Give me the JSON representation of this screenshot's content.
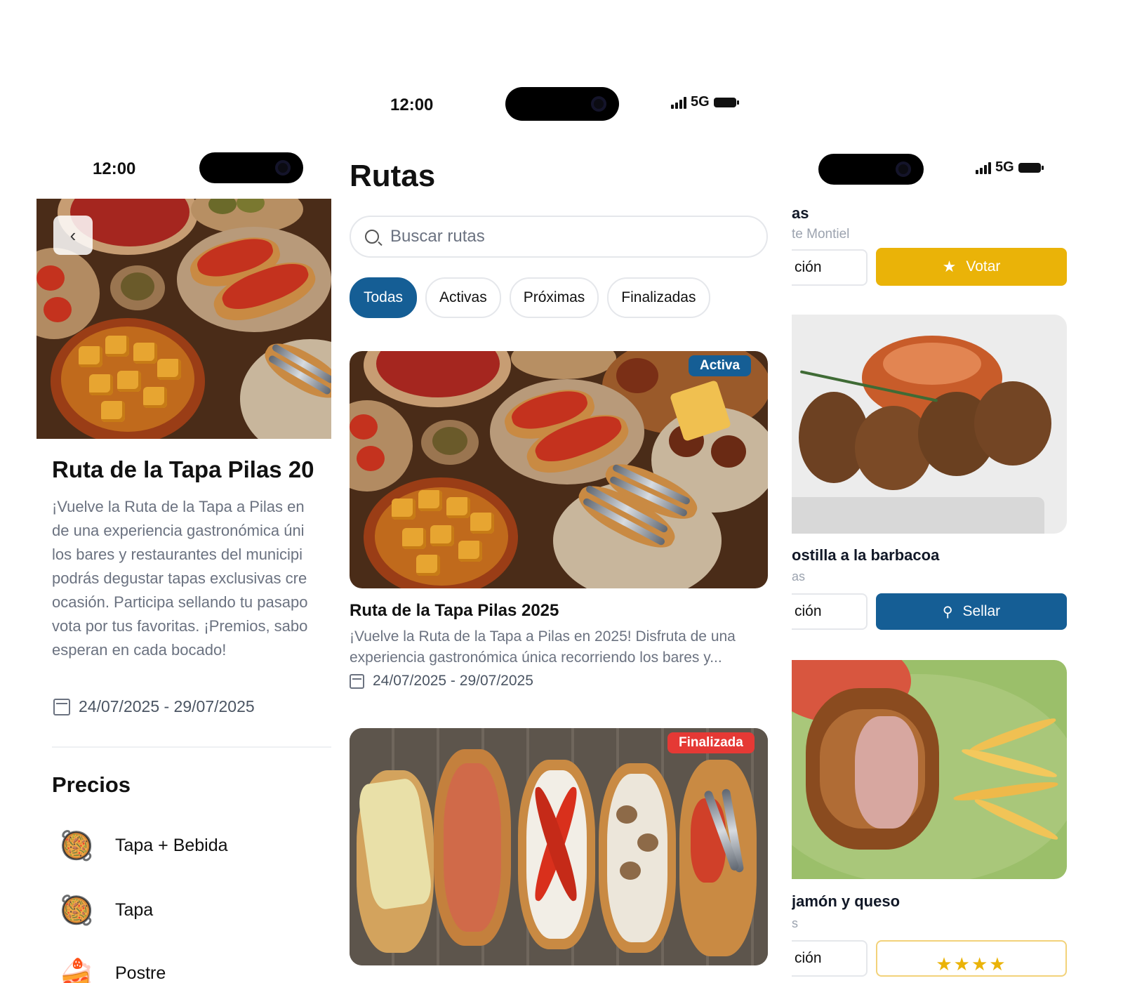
{
  "left_screen": {
    "status_time": "12:00",
    "back_label": "‹",
    "title": "Ruta de la Tapa Pilas 20",
    "description_lines": [
      "¡Vuelve la Ruta de la Tapa a Pilas en",
      "de una experiencia gastronómica úni",
      "los bares y restaurantes del municipi",
      "podrás degustar tapas exclusivas cre",
      "ocasión. Participa sellando tu pasapo",
      "vota por tus favoritas. ¡Premios, sabo",
      "esperan en cada bocado!"
    ],
    "dates": "24/07/2025 - 29/07/2025",
    "prices_title": "Precios",
    "prices": [
      {
        "emoji": "🥘",
        "label": "Tapa + Bebida"
      },
      {
        "emoji": "🥘",
        "label": "Tapa"
      },
      {
        "emoji": "🍰",
        "label": "Postre"
      }
    ]
  },
  "center_screen": {
    "status_time": "12:00",
    "network": "5G",
    "title": "Rutas",
    "search_placeholder": "Buscar rutas",
    "filters": [
      "Todas",
      "Activas",
      "Próximas",
      "Finalizadas"
    ],
    "active_filter": "Todas",
    "routes": [
      {
        "badge": "Activa",
        "badge_color": "#155e95",
        "title": "Ruta de la Tapa Pilas 2025",
        "description_lines": [
          "¡Vuelve la Ruta de la Tapa a Pilas en 2025! Disfruta de una",
          "experiencia gastronómica única recorriendo los bares y..."
        ],
        "dates": "24/07/2025 - 29/07/2025"
      },
      {
        "badge": "Finalizada",
        "badge_color": "#e53935"
      }
    ]
  },
  "right_screen": {
    "network": "5G",
    "header_title": "as",
    "header_subtitle": "te Montiel",
    "vote_row": {
      "left_label": "ción",
      "vote_label": "Votar"
    },
    "items": [
      {
        "title": "ostilla a la barbacoa",
        "subtitle": "as",
        "left_label": "ción",
        "action_label": "Sellar"
      },
      {
        "title": "jamón y queso",
        "subtitle": "s",
        "left_label": "ción",
        "rating": "★★★★"
      }
    ]
  },
  "colors": {
    "primary": "#155e95",
    "vote": "#eab308",
    "finished": "#e53935"
  }
}
